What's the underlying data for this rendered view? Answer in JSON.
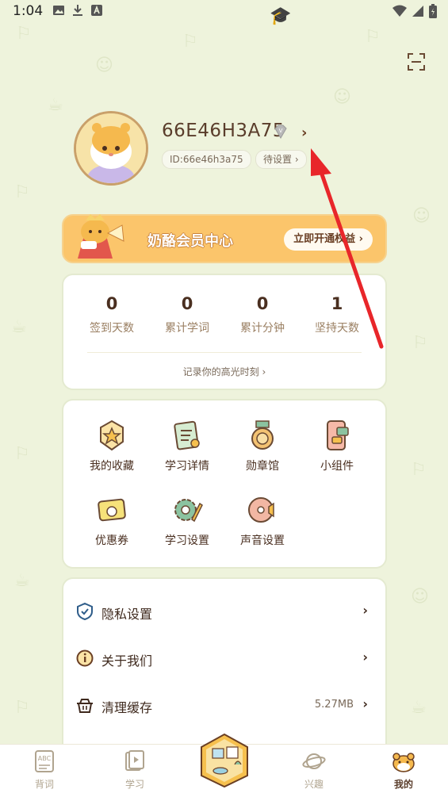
{
  "status_bar": {
    "time": "1:04"
  },
  "profile": {
    "username": "66E46H3A75",
    "id_label": "ID:66e46h3a75",
    "setting_label": "待设置"
  },
  "vip_banner": {
    "title": "奶酪会员中心",
    "button_label": "立即开通权益"
  },
  "stats": {
    "items": [
      {
        "value": "0",
        "label": "签到天数"
      },
      {
        "value": "0",
        "label": "累计学词"
      },
      {
        "value": "0",
        "label": "累计分钟"
      },
      {
        "value": "1",
        "label": "坚持天数"
      }
    ],
    "highlight_link": "记录你的高光时刻"
  },
  "features": {
    "items": [
      {
        "label": "我的收藏",
        "icon": "badge-star-icon"
      },
      {
        "label": "学习详情",
        "icon": "notes-icon"
      },
      {
        "label": "勋章馆",
        "icon": "medal-icon"
      },
      {
        "label": "小组件",
        "icon": "widget-icon"
      },
      {
        "label": "优惠券",
        "icon": "coupon-icon"
      },
      {
        "label": "学习设置",
        "icon": "gear-pencil-icon"
      },
      {
        "label": "声音设置",
        "icon": "speaker-disc-icon"
      }
    ]
  },
  "menu": {
    "items": [
      {
        "label": "隐私设置",
        "icon": "shield-check-icon",
        "value": ""
      },
      {
        "label": "关于我们",
        "icon": "info-icon",
        "value": ""
      },
      {
        "label": "清理缓存",
        "icon": "basket-icon",
        "value": "5.27MB"
      }
    ]
  },
  "bottom_nav": {
    "items": [
      {
        "label": "背词",
        "icon": "abc-book-icon"
      },
      {
        "label": "学习",
        "icon": "study-book-icon"
      },
      {
        "label": "兴趣",
        "icon": "planet-icon"
      },
      {
        "label": "我的",
        "icon": "hamster-icon"
      }
    ],
    "active": "我的"
  },
  "colors": {
    "background": "#eef3dc",
    "banner": "#fbc56b",
    "text_brown": "#5a3d2b",
    "arrow": "#e8262a"
  }
}
